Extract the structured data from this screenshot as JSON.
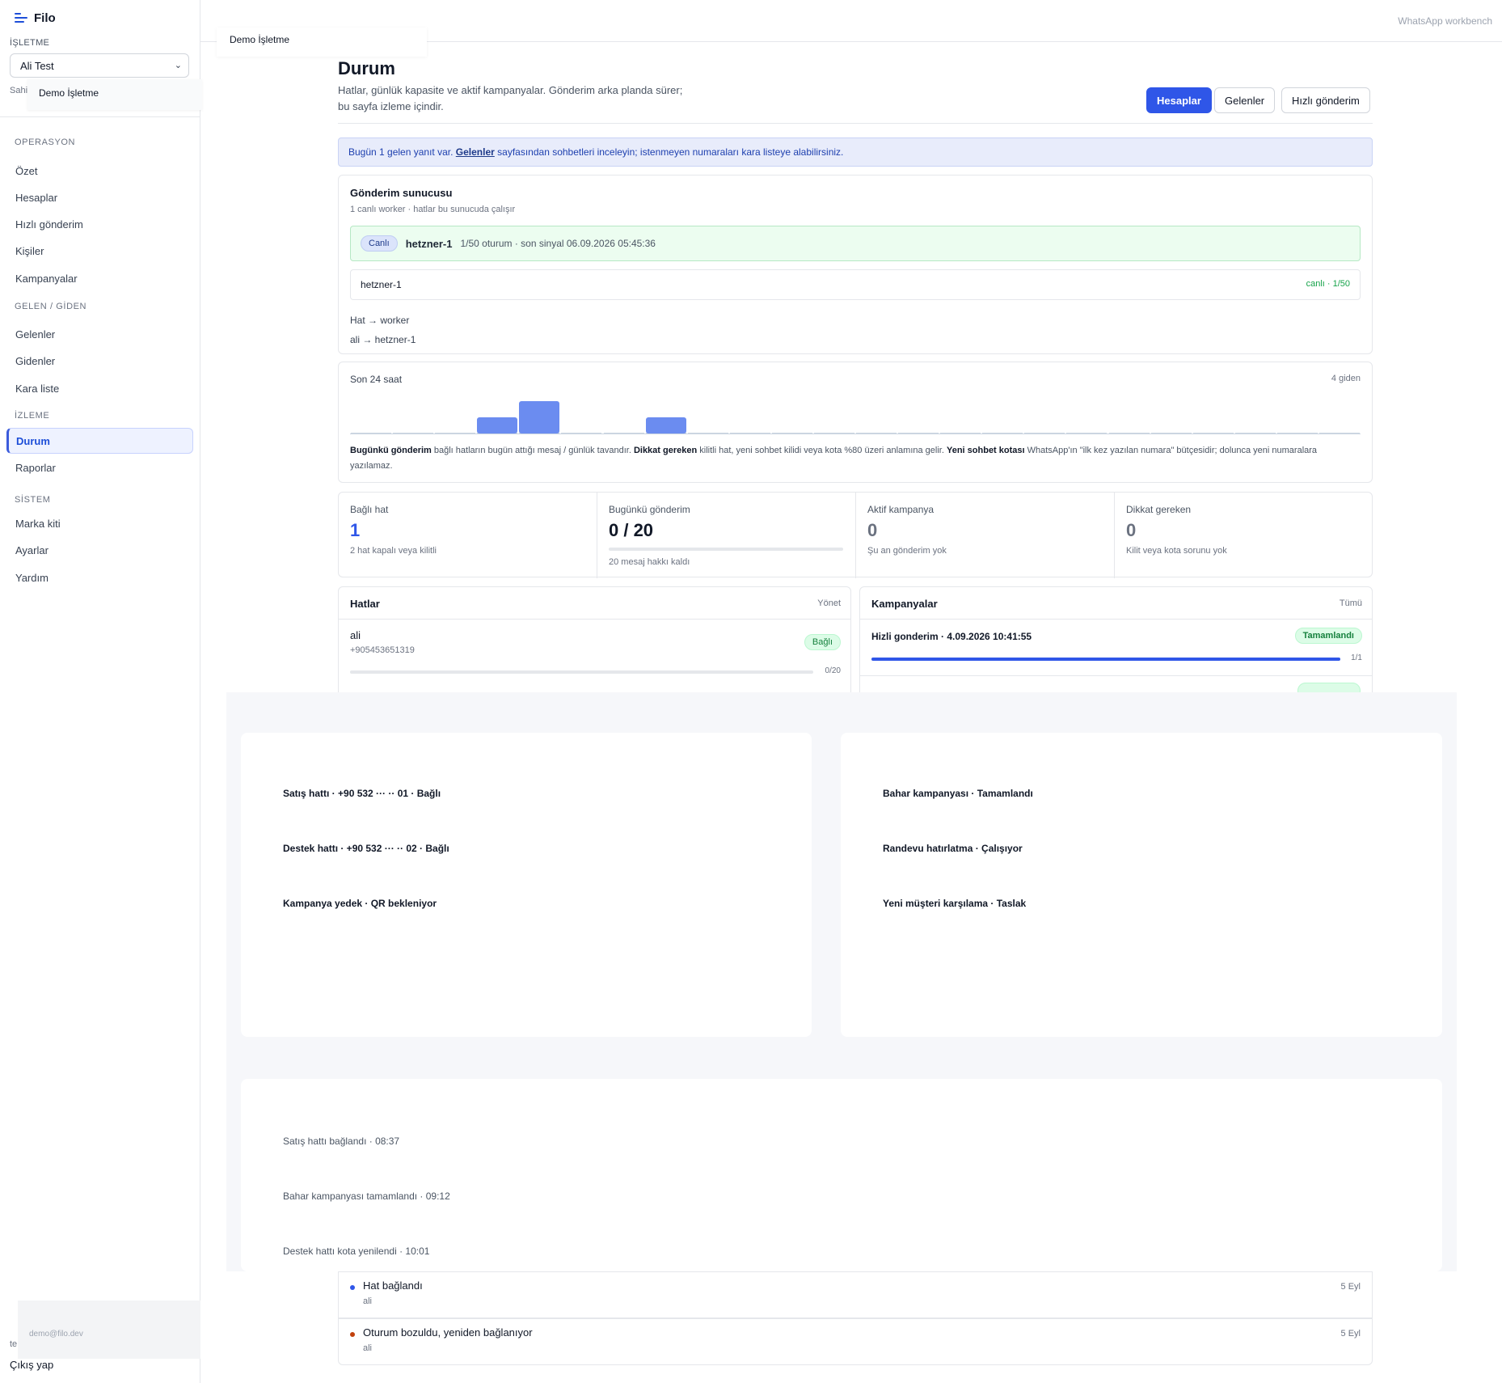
{
  "app": {
    "name": "Filo",
    "workbench_label": "WhatsApp workbench"
  },
  "sidebar": {
    "business_section_label": "İŞLETME",
    "business_select_value": "Ali Test",
    "business_dropdown_option": "Demo İşletme",
    "owner_text": "Sahi",
    "groups": [
      {
        "label": "OPERASYON",
        "items": [
          "Özet",
          "Hesaplar",
          "Hızlı gönderim",
          "Kişiler",
          "Kampanyalar"
        ]
      },
      {
        "label": "GELEN / GİDEN",
        "items": [
          "Gelenler",
          "Gidenler",
          "Kara liste"
        ]
      },
      {
        "label": "İZLEME",
        "items": [
          "Durum",
          "Raporlar"
        ]
      },
      {
        "label": "SİSTEM",
        "items": [
          "Marka kiti",
          "Ayarlar",
          "Yardım"
        ]
      }
    ],
    "active_item": "Durum",
    "user_email": "demo@filo.dev",
    "user_prefix": "te",
    "logout_label": "Çıkış yap"
  },
  "topbar": {
    "business_chip": "Demo İşletme"
  },
  "header": {
    "title": "Durum",
    "subtitle": "Hatlar, günlük kapasite ve aktif kampanyalar. Gönderim arka planda sürer; bu sayfa izleme içindir.",
    "buttons": {
      "accounts": "Hesaplar",
      "incoming": "Gelenler",
      "quick_send": "Hızlı gönderim"
    }
  },
  "notice": {
    "prefix": "Bugün 1 gelen yanıt var.",
    "link": "Gelenler",
    "suffix": "sayfasından sohbetleri inceleyin; istenmeyen numaraları kara listeye alabilirsiniz."
  },
  "server": {
    "title": "Gönderim sunucusu",
    "subtitle": "1 canlı worker · hatlar bu sunucuda çalışır",
    "live_badge": "Canlı",
    "worker_name": "hetzner-1",
    "worker_meta": "1/50 oturum · son sinyal 06.09.2026 05:45:36",
    "worker_row_name": "hetzner-1",
    "worker_row_status": "canlı · 1/50",
    "mapping_header": "Hat → worker",
    "mapping_row": "ali → hetzner-1"
  },
  "activity": {
    "title": "Son 24 saat",
    "total": "4 giden",
    "hourly_counts": [
      0,
      0,
      0,
      1,
      2,
      0,
      0,
      1,
      0,
      0,
      0,
      0,
      0,
      0,
      0,
      0,
      0,
      0,
      0,
      0,
      0,
      0,
      0,
      0
    ],
    "note_b1": "Bugünkü gönderim",
    "note_t1": " bağlı hatların bugün attığı mesaj / günlük tavandır. ",
    "note_b2": "Dikkat gereken",
    "note_t2": " kilitli hat, yeni sohbet kilidi veya kota %80 üzeri anlamına gelir. ",
    "note_b3": "Yeni sohbet kotası",
    "note_t3": " WhatsApp'ın \"ilk kez yazılan numara\" bütçesidir; dolunca yeni numaralara yazılamaz."
  },
  "stats": {
    "connected": {
      "label": "Bağlı hat",
      "value": "1",
      "sub": "2 hat kapalı veya kilitli",
      "color": "#2f56e8"
    },
    "today": {
      "label": "Bugünkü gönderim",
      "value": "0 / 20",
      "sub": "20 mesaj hakkı kaldı",
      "progress": 0
    },
    "campaigns": {
      "label": "Aktif kampanya",
      "value": "0",
      "sub": "Şu an gönderim yok"
    },
    "attention": {
      "label": "Dikkat gereken",
      "value": "0",
      "sub": "Kilit veya kota sorunu yok"
    }
  },
  "lines_panel": {
    "title": "Hatlar",
    "action": "Yönet",
    "items": [
      {
        "name": "ali",
        "phone": "+905453651319",
        "status": "Bağlı",
        "usage": "0/20",
        "progress": 0
      }
    ]
  },
  "campaigns_panel": {
    "title": "Kampanyalar",
    "action": "Tümü",
    "items": [
      {
        "name": "Hizli gonderim · 4.09.2026 10:41:55",
        "status": "Tamamlandı",
        "count": "1/1",
        "progress": 1
      }
    ]
  },
  "overlay": {
    "lines": [
      "Satış hattı · +90 532 ··· ·· 01 · Bağlı",
      "Destek hattı · +90 532 ··· ·· 02 · Bağlı",
      "Kampanya yedek · QR bekleniyor"
    ],
    "campaigns": [
      "Bahar kampanyası · Tamamlandı",
      "Randevu hatırlatma · Çalışıyor",
      "Yeni müşteri karşılama · Taslak"
    ],
    "events": [
      "Satış hattı bağlandı · 08:37",
      "Bahar kampanyası tamamlandı · 09:12",
      "Destek hattı kota yenilendi · 10:01"
    ]
  },
  "events": [
    {
      "title": "Hat bağlandı",
      "sub": "ali",
      "date": "5 Eyl",
      "color": "#2f56e8"
    },
    {
      "title": "Oturum bozuldu, yeniden bağlanıyor",
      "sub": "ali",
      "date": "5 Eyl",
      "color": "#c2410c"
    }
  ],
  "colors": {
    "accent": "#2f56e8",
    "success": "#16a34a",
    "bar": "#6b8cf0"
  }
}
